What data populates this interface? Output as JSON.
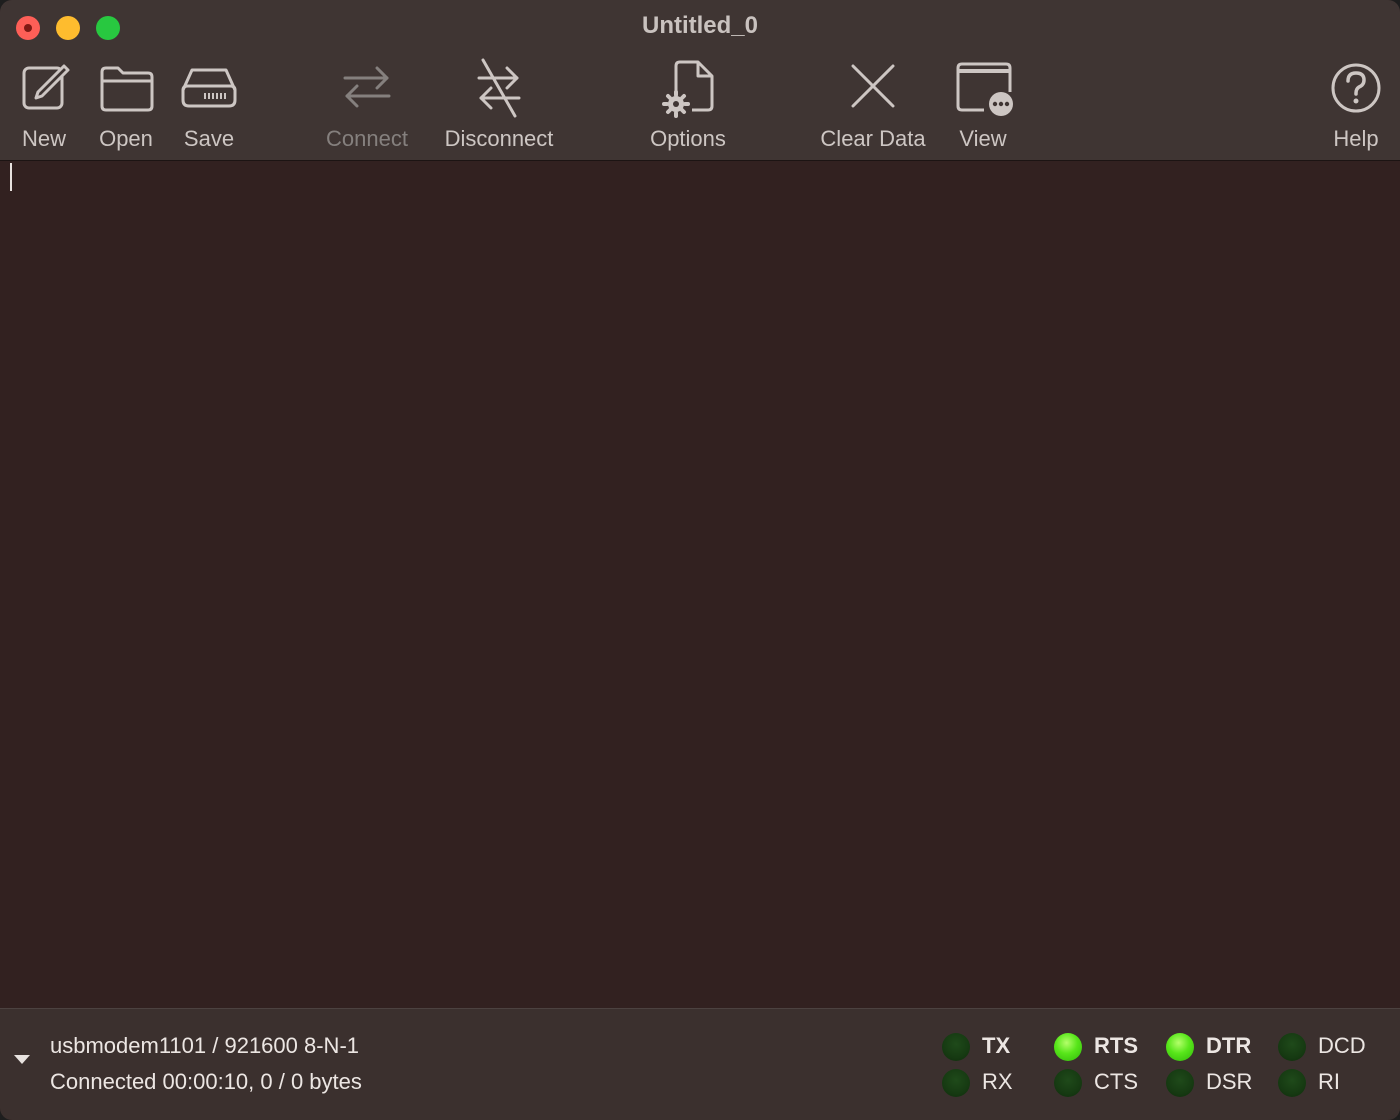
{
  "window": {
    "title": "Untitled_0"
  },
  "toolbar": {
    "new_label": "New",
    "open_label": "Open",
    "save_label": "Save",
    "connect_label": "Connect",
    "disconnect_label": "Disconnect",
    "options_label": "Options",
    "clear_label": "Clear Data",
    "view_label": "View",
    "help_label": "Help"
  },
  "status": {
    "port_settings": "usbmodem1101 / 921600 8-N-1",
    "connection": "Connected 00:00:10, 0 / 0 bytes"
  },
  "signals": [
    {
      "label": "TX",
      "state": "off",
      "bold": true
    },
    {
      "label": "RX",
      "state": "off",
      "bold": false
    },
    {
      "label": "RTS",
      "state": "on",
      "bold": true
    },
    {
      "label": "CTS",
      "state": "off",
      "bold": false
    },
    {
      "label": "DTR",
      "state": "on",
      "bold": true
    },
    {
      "label": "DSR",
      "state": "off",
      "bold": false
    },
    {
      "label": "DCD",
      "state": "off",
      "bold": false
    },
    {
      "label": "RI",
      "state": "off",
      "bold": false
    }
  ],
  "colors": {
    "led_on": "#58e61a",
    "led_off": "#163a12",
    "background": "#322120"
  }
}
